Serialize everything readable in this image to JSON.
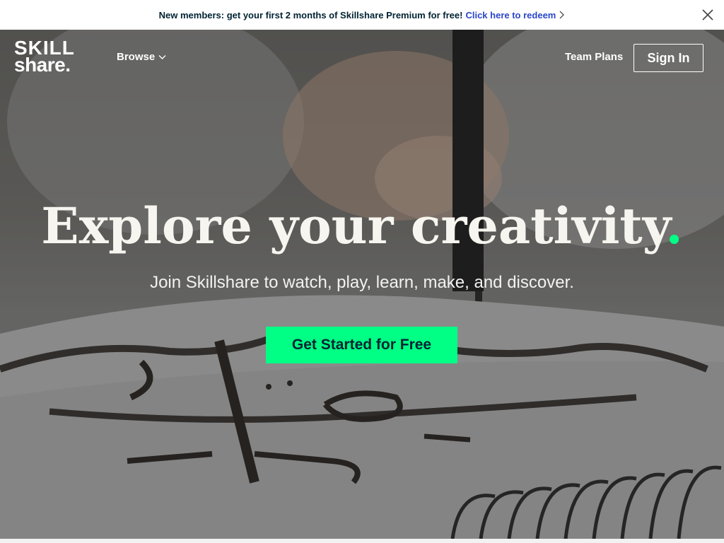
{
  "promo": {
    "text": "New members: get your first 2 months of Skillshare Premium for free!",
    "link": "Click here to redeem",
    "chevron_icon": "chevron-right-icon",
    "close_icon": "close-icon"
  },
  "nav": {
    "logo_line1": "SKILL",
    "logo_line2": "share.",
    "browse": "Browse",
    "browse_icon": "chevron-down-icon",
    "team_plans": "Team Plans",
    "sign_in": "Sign In"
  },
  "hero": {
    "headline": "Explore your creativity",
    "headline_dot": ".",
    "subhead": "Join Skillshare to watch, play, learn, make, and discover.",
    "cta": "Get Started for Free"
  },
  "colors": {
    "accent": "#00ff84",
    "link": "#2a46c8",
    "text_dark": "#002333"
  }
}
